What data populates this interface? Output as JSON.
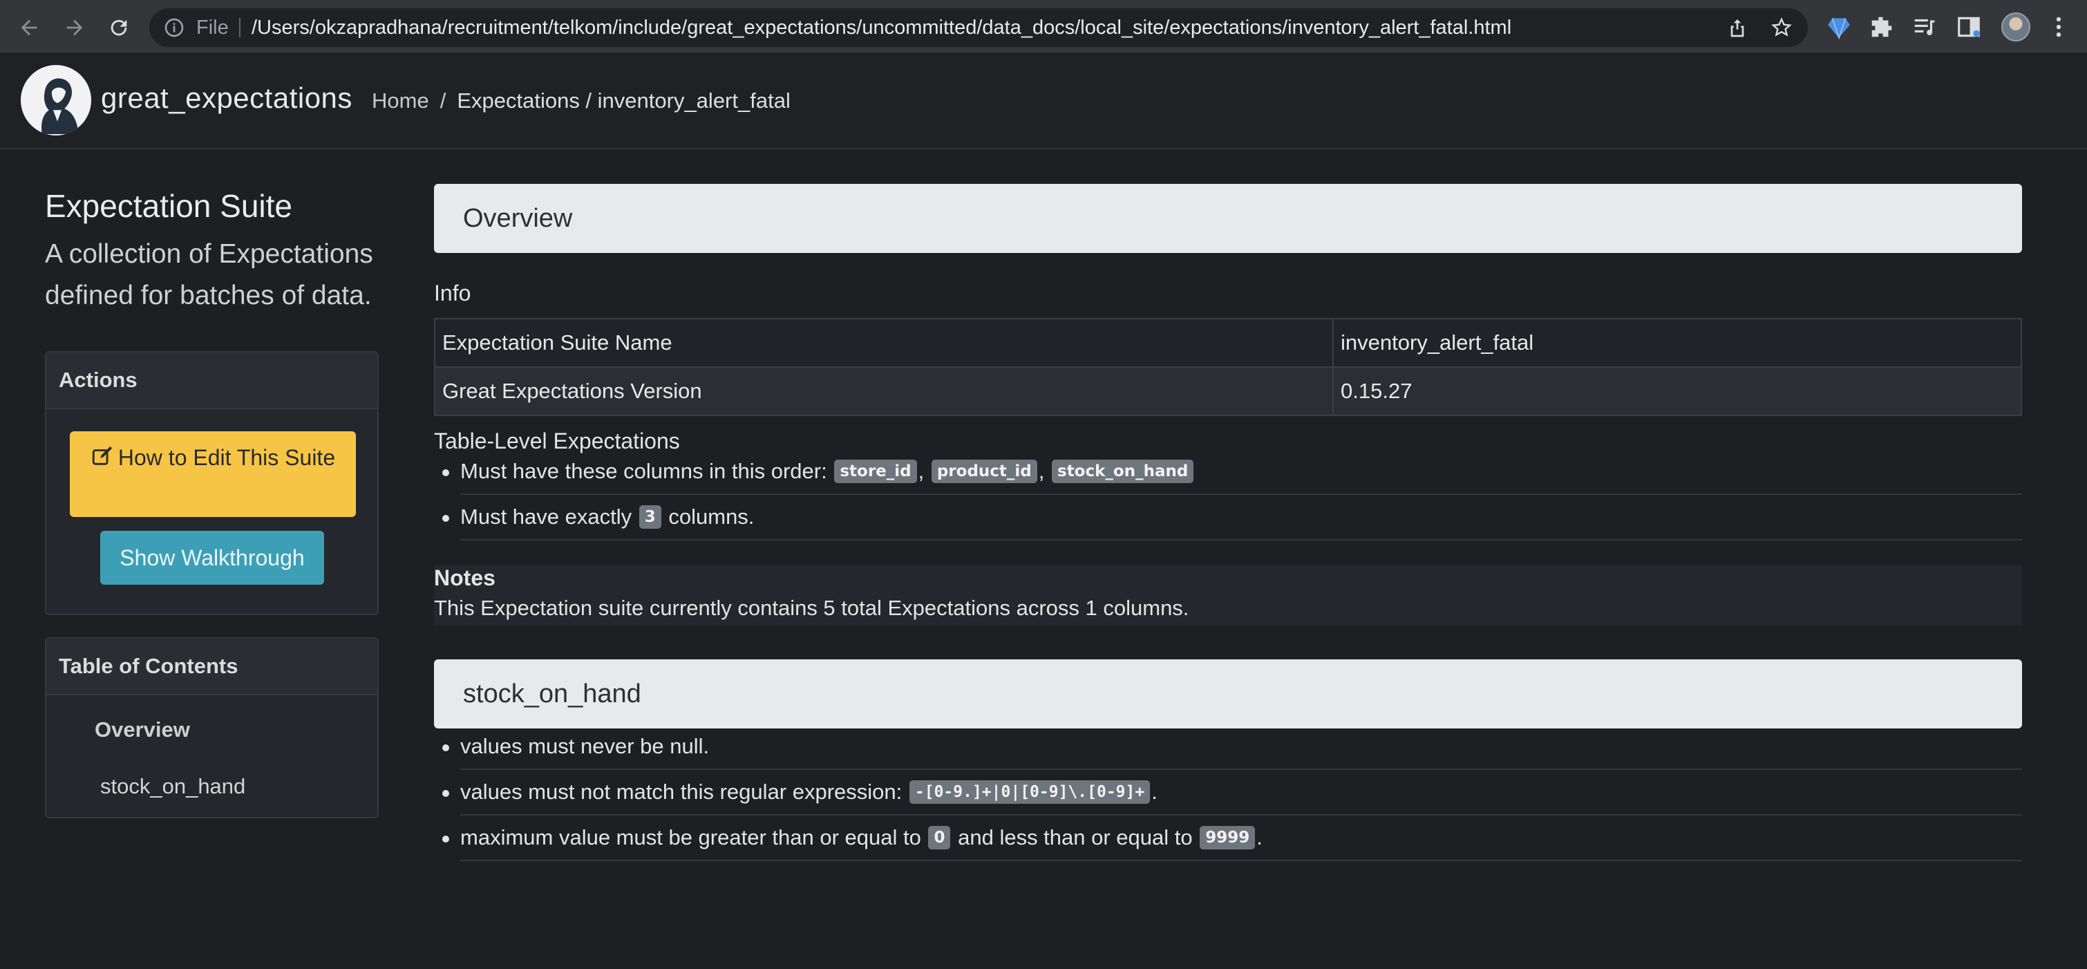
{
  "browser": {
    "file_label": "File",
    "url": "/Users/okzapradhana/recruitment/telkom/include/great_expectations/uncommitted/data_docs/local_site/expectations/inventory_alert_fatal.html"
  },
  "header": {
    "logo_text": "great_expectations",
    "breadcrumb": {
      "home": "Home",
      "separator": "/",
      "current": "Expectations / inventory_alert_fatal"
    }
  },
  "sidebar": {
    "title": "Expectation Suite",
    "description": "A collection of Expectations defined for batches of data.",
    "actions": {
      "header": "Actions",
      "edit_button": "How to Edit This Suite",
      "walkthrough_button": "Show Walkthrough"
    },
    "toc": {
      "header": "Table of Contents",
      "items": [
        "Overview",
        "stock_on_hand"
      ]
    }
  },
  "main": {
    "overview_title": "Overview",
    "info_heading": "Info",
    "info_table": [
      {
        "label": "Expectation Suite Name",
        "value": "inventory_alert_fatal"
      },
      {
        "label": "Great Expectations Version",
        "value": "0.15.27"
      }
    ],
    "table_level": {
      "heading": "Table-Level Expectations",
      "columns_text": "Must have these columns in this order:",
      "columns": [
        "store_id",
        "product_id",
        "stock_on_hand"
      ],
      "column_count_prefix": "Must have exactly",
      "column_count": "3",
      "column_count_suffix": "columns."
    },
    "notes": {
      "title": "Notes",
      "text": "This Expectation suite currently contains 5 total Expectations across 1 columns."
    },
    "column_section": {
      "title": "stock_on_hand",
      "not_null": "values must never be null.",
      "regex_text": "values must not match this regular expression:",
      "regex": "-[0-9.]+|0|[0-9]\\.[0-9]+",
      "range_prefix": "maximum value must be greater than or equal to",
      "range_min": "0",
      "range_mid": "and less than or equal to",
      "range_max": "9999"
    }
  },
  "colors": {
    "edit_button": "#f7c545",
    "walkthrough_button": "#3d9fb6",
    "section_header_bg": "#e8e9eb",
    "page_bg": "#1d1f22"
  }
}
